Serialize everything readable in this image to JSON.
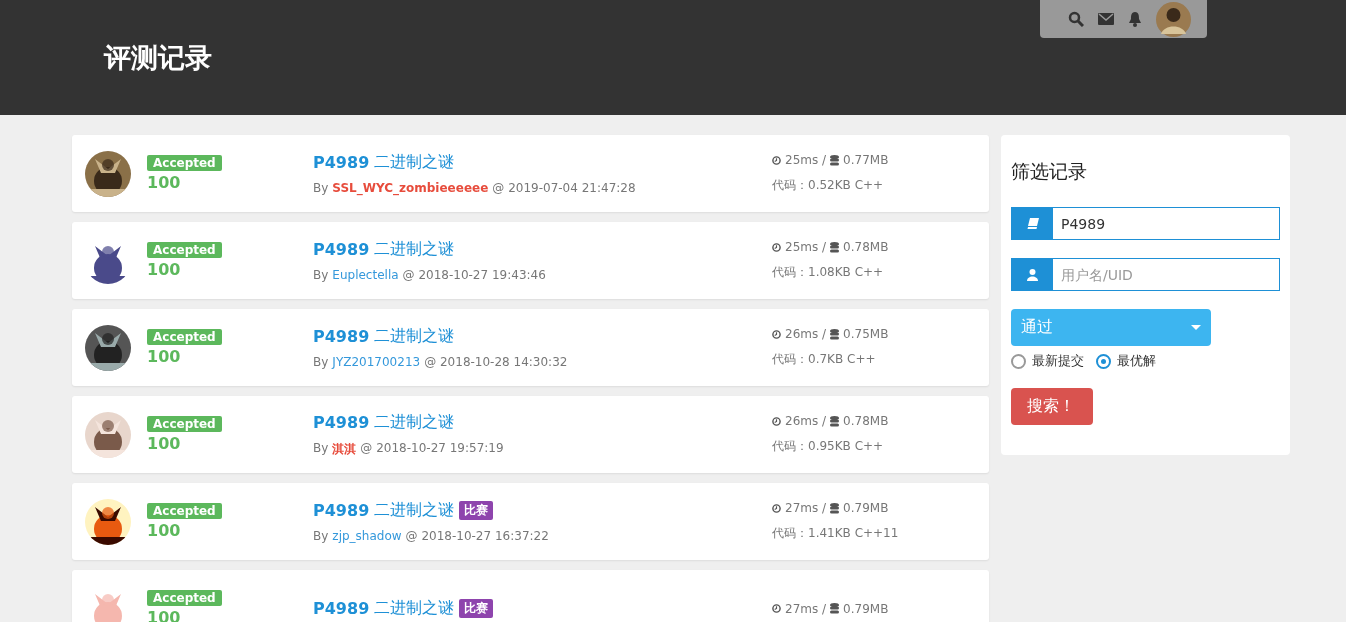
{
  "header": {
    "title": "评测记录"
  },
  "records": [
    {
      "status": "Accepted",
      "score": "100",
      "problem_id": "P4989",
      "problem_name": "二进制之谜",
      "by": "By",
      "user": {
        "name": "SSL_WYC_zombieeeeee",
        "color": "#e74c3c",
        "bold": true
      },
      "at": "@ 2019-07-04 21:47:28",
      "time": "25ms /",
      "memory": "0.77MB",
      "code": "代码：0.52KB C++"
    },
    {
      "status": "Accepted",
      "score": "100",
      "problem_id": "P4989",
      "problem_name": "二进制之谜",
      "by": "By",
      "user": {
        "name": "Euplectella",
        "color": "#3498db",
        "bold": false
      },
      "at": "@ 2018-10-27 19:43:46",
      "time": "25ms /",
      "memory": "0.78MB",
      "code": "代码：1.08KB C++"
    },
    {
      "status": "Accepted",
      "score": "100",
      "problem_id": "P4989",
      "problem_name": "二进制之谜",
      "by": "By",
      "user": {
        "name": "JYZ201700213",
        "color": "#3498db",
        "bold": false
      },
      "at": "@ 2018-10-28 14:30:32",
      "time": "26ms /",
      "memory": "0.75MB",
      "code": "代码：0.7KB C++"
    },
    {
      "status": "Accepted",
      "score": "100",
      "problem_id": "P4989",
      "problem_name": "二进制之谜",
      "by": "By",
      "user": {
        "name": "淇淇",
        "color": "#e74c3c",
        "bold": true
      },
      "at": "@ 2018-10-27 19:57:19",
      "time": "26ms /",
      "memory": "0.78MB",
      "code": "代码：0.95KB C++"
    },
    {
      "status": "Accepted",
      "score": "100",
      "problem_id": "P4989",
      "problem_name": "二进制之谜",
      "tag": "比赛",
      "by": "By",
      "user": {
        "name": "zjp_shadow",
        "color": "#3498db",
        "bold": false
      },
      "at": "@ 2018-10-27 16:37:22",
      "time": "27ms /",
      "memory": "0.79MB",
      "code": "代码：1.41KB C++11"
    },
    {
      "status": "Accepted",
      "score": "100",
      "problem_id": "P4989",
      "problem_name": "二进制之谜",
      "tag": "比赛",
      "time": "27ms /",
      "memory": "0.79MB"
    }
  ],
  "filter": {
    "title": "筛选记录",
    "problem_field": {
      "value": "P4989"
    },
    "user_field": {
      "placeholder": "用户名/UID"
    },
    "status_select": {
      "value": "通过"
    },
    "order": [
      {
        "label": "最新提交",
        "selected": false
      },
      {
        "label": "最优解",
        "selected": true
      }
    ],
    "search_button": "搜索！"
  }
}
